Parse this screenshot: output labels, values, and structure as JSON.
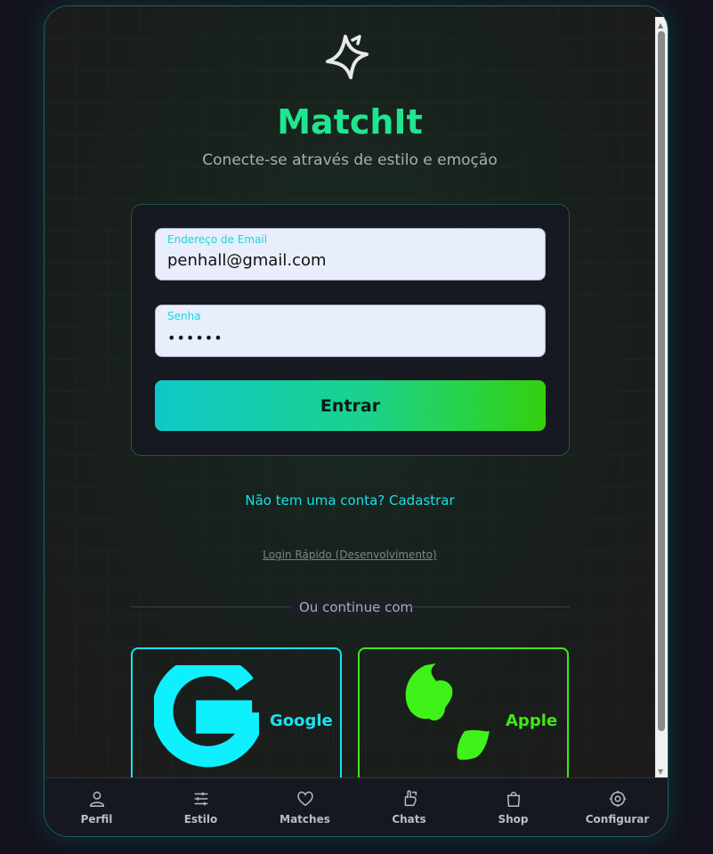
{
  "app": {
    "title": "MatchIt",
    "tagline": "Conecte-se através de estilo e emoção",
    "logo_icon": "star-sparkle-icon"
  },
  "login_form": {
    "email_label": "Endereço de Email",
    "email_value": "penhall@gmail.com",
    "password_label": "Senha",
    "password_value": "••••••",
    "submit_label": "Entrar"
  },
  "links": {
    "signup": "Não tem uma conta? Cadastrar",
    "quick_login": "Login Rápido (Desenvolvimento)"
  },
  "divider": {
    "label": "Ou continue com"
  },
  "social": [
    {
      "label": "Google",
      "icon": "google-icon",
      "color": "#19e2ef"
    },
    {
      "label": "Apple",
      "icon": "apple-icon",
      "color": "#3fe81a"
    }
  ],
  "bottom_nav": [
    {
      "label": "Perfil",
      "icon": "user-icon"
    },
    {
      "label": "Estilo",
      "icon": "sliders-icon"
    },
    {
      "label": "Matches",
      "icon": "heart-icon"
    },
    {
      "label": "Chats",
      "icon": "chat-hand-icon"
    },
    {
      "label": "Shop",
      "icon": "shopping-bag-icon"
    },
    {
      "label": "Configurar",
      "icon": "settings-icon"
    }
  ],
  "colors": {
    "accent_green": "#1fe68e",
    "accent_cyan": "#19e0e6",
    "apple_green": "#3fe81a",
    "background": "#12131c"
  }
}
